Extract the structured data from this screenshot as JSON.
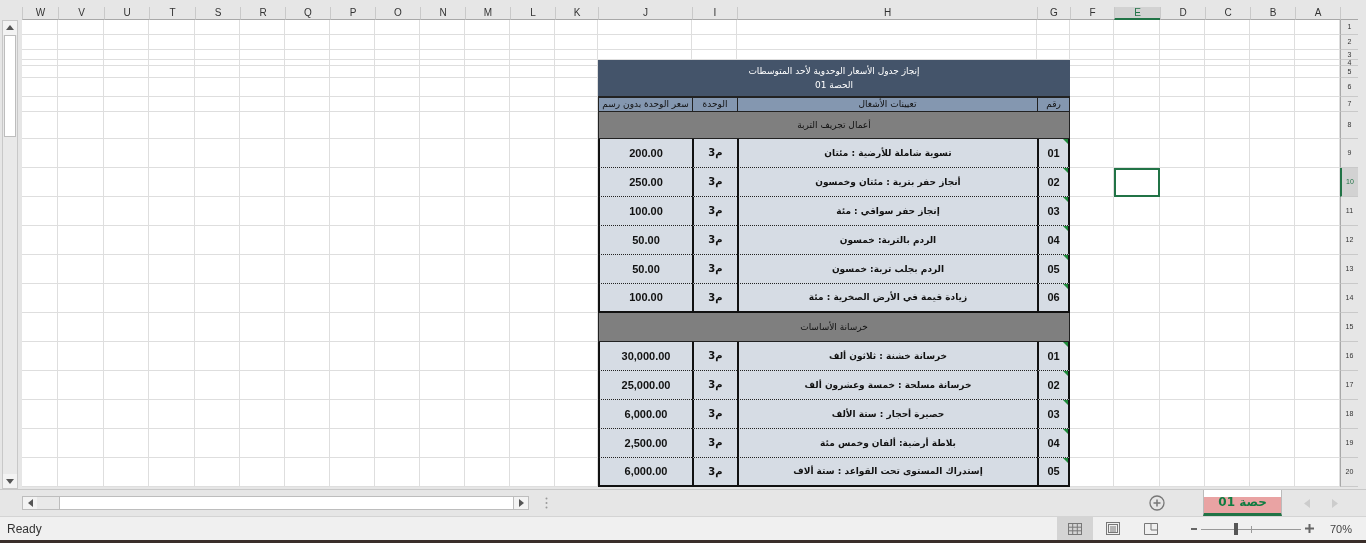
{
  "sheet": {
    "column_headers": [
      {
        "label": "A",
        "selected": false
      },
      {
        "label": "B",
        "selected": false
      },
      {
        "label": "C",
        "selected": false
      },
      {
        "label": "D",
        "selected": false
      },
      {
        "label": "E",
        "selected": true
      },
      {
        "label": "F",
        "selected": false
      },
      {
        "label": "G",
        "selected": false
      },
      {
        "label": "H",
        "selected": false
      },
      {
        "label": "I",
        "selected": false
      },
      {
        "label": "J",
        "selected": false
      },
      {
        "label": "K",
        "selected": false
      },
      {
        "label": "L",
        "selected": false
      },
      {
        "label": "M",
        "selected": false
      },
      {
        "label": "N",
        "selected": false
      },
      {
        "label": "O",
        "selected": false
      },
      {
        "label": "P",
        "selected": false
      },
      {
        "label": "Q",
        "selected": false
      },
      {
        "label": "R",
        "selected": false
      },
      {
        "label": "S",
        "selected": false
      },
      {
        "label": "T",
        "selected": false
      },
      {
        "label": "U",
        "selected": false
      },
      {
        "label": "V",
        "selected": false
      },
      {
        "label": "W",
        "selected": false
      }
    ],
    "row_headers": [
      {
        "label": "1",
        "selected": false
      },
      {
        "label": "2",
        "selected": false
      },
      {
        "label": "3",
        "selected": false
      },
      {
        "label": "4",
        "selected": false
      },
      {
        "label": "5",
        "selected": false
      },
      {
        "label": "6",
        "selected": false
      },
      {
        "label": "7",
        "selected": false
      },
      {
        "label": "8",
        "selected": false
      },
      {
        "label": "9",
        "selected": false
      },
      {
        "label": "10",
        "selected": true
      },
      {
        "label": "11",
        "selected": false
      },
      {
        "label": "12",
        "selected": false
      },
      {
        "label": "13",
        "selected": false
      },
      {
        "label": "14",
        "selected": false
      },
      {
        "label": "15",
        "selected": false
      },
      {
        "label": "16",
        "selected": false
      },
      {
        "label": "17",
        "selected": false
      },
      {
        "label": "18",
        "selected": false
      },
      {
        "label": "19",
        "selected": false
      },
      {
        "label": "20",
        "selected": false
      }
    ]
  },
  "table": {
    "title": "إنجاز جدول الأسعار الوحدوية لأحد المتوسطات",
    "subtitle": "الحصة 01",
    "columns": {
      "number": "رقم",
      "description": "تعيينات الأشغال",
      "unit": "الوحدة",
      "price": "سعر الوحدة بدون رسم"
    },
    "sections": [
      {
        "title": "أعمال تجريف التربة",
        "rows": [
          {
            "number": "01",
            "description": "تسوية شاملة للأرضية : مئتان",
            "unit": "م3",
            "price": "200.00"
          },
          {
            "number": "02",
            "description": "أنجاز حفر بترية : مئتان وخمسون",
            "unit": "م3",
            "price": "250.00"
          },
          {
            "number": "03",
            "description": "إنجاز حفر سواقي : مئة",
            "unit": "م3",
            "price": "100.00"
          },
          {
            "number": "04",
            "description": "الردم بالتربة: خمسون",
            "unit": "م3",
            "price": "50.00"
          },
          {
            "number": "05",
            "description": "الردم بجلب تربة: خمسون",
            "unit": "م3",
            "price": "50.00"
          },
          {
            "number": "06",
            "description": "زيادة قيمة في الأرض الصخرية : مئة",
            "unit": "م3",
            "price": "100.00"
          }
        ]
      },
      {
        "title": "خرسانة الأساسات",
        "rows": [
          {
            "number": "01",
            "description": "خرسانة خشنة : ثلاثون ألف",
            "unit": "م3",
            "price": "30,000.00"
          },
          {
            "number": "02",
            "description": "خرسانة مسلحة : خمسة وعشرون ألف",
            "unit": "م3",
            "price": "25,000.00"
          },
          {
            "number": "03",
            "description": "حصيرة أحجار : ستة الألف",
            "unit": "م3",
            "price": "6,000.00"
          },
          {
            "number": "04",
            "description": "بلاطة أرضية: ألفان وخمس مئة",
            "unit": "م3",
            "price": "2,500.00"
          },
          {
            "number": "05",
            "description": "إستدراك المستوى تحت القواعد : ستة ألاف",
            "unit": "م3",
            "price": "6,000.00"
          }
        ]
      }
    ]
  },
  "sheet_tabs": [
    {
      "label": "حصة 01",
      "selected": true
    }
  ],
  "status_bar": {
    "status": "Ready",
    "views": [
      {
        "kind": "normal",
        "selected": true
      },
      {
        "kind": "page_layout",
        "selected": false
      },
      {
        "kind": "page_break",
        "selected": false
      }
    ],
    "zoom": {
      "level": 0.35,
      "reading": "70%"
    }
  }
}
